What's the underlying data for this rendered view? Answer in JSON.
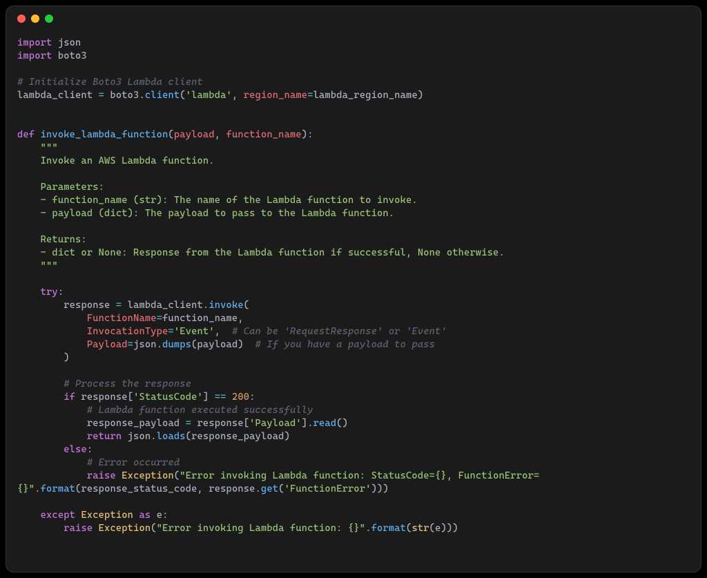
{
  "colors": {
    "window_bg": "#1b1b1b",
    "traffic_close": "#ff5f56",
    "traffic_min": "#ffbd2e",
    "traffic_max": "#27c93f",
    "keyword": "#c678dd",
    "module": "#e5c07b",
    "comment": "#5c6370",
    "string": "#98c379",
    "number": "#d19a66",
    "function": "#61afef",
    "variable": "#e06c75",
    "operator": "#56b6c2",
    "default": "#abb2bf"
  },
  "tokens": {
    "l1_import": "import",
    "l1_json": " json",
    "l2_import": "import",
    "l2_boto3": " boto3",
    "l4_cmt": "# Initialize Boto3 Lambda client",
    "l5_var": "lambda_client ",
    "l5_assign": "=",
    "l5_boto3": " boto3",
    "l5_dot1": ".",
    "l5_client": "client",
    "l5_p1": "(",
    "l5_str": "'lambda'",
    "l5_comma": ", ",
    "l5_kw": "region_name",
    "l5_eq": "=",
    "l5_rn": "lambda_region_name",
    "l5_p2": ")",
    "l8_def": "def",
    "l8_name": " invoke_lambda_function",
    "l8_p1": "(",
    "l8_a1": "payload",
    "l8_c1": ", ",
    "l8_a2": "function_name",
    "l8_p2": "):",
    "l9_doc": "    \"\"\"",
    "l10_doc": "    Invoke an AWS Lambda function.",
    "l12_doc": "    Parameters:",
    "l13_doc": "    - function_name (str): The name of the Lambda function to invoke.",
    "l14_doc": "    - payload (dict): The payload to pass to the Lambda function.",
    "l16_doc": "    Returns:",
    "l17_doc": "    - dict or None: Response from the Lambda function if successful, None otherwise.",
    "l18_doc": "    \"\"\"",
    "l20_try": "    try",
    "l20_colon": ":",
    "l21_ind": "        ",
    "l21_var": "response ",
    "l21_eq": "=",
    "l21_lc": " lambda_client",
    "l21_dot": ".",
    "l21_inv": "invoke",
    "l21_p": "(",
    "l22_ind": "            ",
    "l22_kw": "FunctionName",
    "l22_eq": "=",
    "l22_fn": "function_name",
    "l22_c": ",",
    "l23_ind": "            ",
    "l23_kw": "InvocationType",
    "l23_eq": "=",
    "l23_str": "'Event'",
    "l23_c": ",  ",
    "l23_cmt": "# Can be 'RequestResponse' or 'Event'",
    "l24_ind": "            ",
    "l24_kw": "Payload",
    "l24_eq": "=",
    "l24_json": "json",
    "l24_dot": ".",
    "l24_dumps": "dumps",
    "l24_p1": "(",
    "l24_pl": "payload",
    "l24_p2": ")  ",
    "l24_cmt": "# If you have a payload to pass",
    "l25": "        )",
    "l27_ind": "        ",
    "l27_cmt": "# Process the response",
    "l28_ind": "        ",
    "l28_if": "if",
    "l28_resp": " response",
    "l28_br1": "[",
    "l28_key": "'StatusCode'",
    "l28_br2": "] ",
    "l28_eq": "==",
    "l28_sp": " ",
    "l28_num": "200",
    "l28_colon": ":",
    "l29_ind": "            ",
    "l29_cmt": "# Lambda function executed successfully",
    "l30_ind": "            ",
    "l30_var": "response_payload ",
    "l30_eq": "=",
    "l30_resp": " response",
    "l30_br1": "[",
    "l30_key": "'Payload'",
    "l30_br2": "]",
    "l30_dot": ".",
    "l30_read": "read",
    "l30_p": "()",
    "l31_ind": "            ",
    "l31_ret": "return",
    "l31_json": " json",
    "l31_dot": ".",
    "l31_loads": "loads",
    "l31_p1": "(",
    "l31_rp": "response_payload",
    "l31_p2": ")",
    "l32_ind": "        ",
    "l32_else": "else",
    "l32_colon": ":",
    "l33_ind": "            ",
    "l33_cmt": "# Error occurred",
    "l34_ind": "            ",
    "l34_raise": "raise",
    "l34_exc": " Exception",
    "l34_p1": "(",
    "l34_str": "\"Error invoking Lambda function: StatusCode={}, FunctionError=\n{}\"",
    "l34_dot": ".",
    "l34_fmt": "format",
    "l34_p2": "(",
    "l34_a1": "response_status_code",
    "l34_c": ", ",
    "l34_a2": "response",
    "l34_dot2": ".",
    "l34_get": "get",
    "l34_p3": "(",
    "l34_key": "'FunctionError'",
    "l34_p4": ")))",
    "l36_ind": "    ",
    "l36_except": "except",
    "l36_exc": " Exception ",
    "l36_as": "as",
    "l36_e": " e",
    "l36_colon": ":",
    "l37_ind": "        ",
    "l37_raise": "raise",
    "l37_exc": " Exception",
    "l37_p1": "(",
    "l37_str": "\"Error invoking Lambda function: {}\"",
    "l37_dot": ".",
    "l37_fmt": "format",
    "l37_p2": "(",
    "l37_str2": "str",
    "l37_p3": "(",
    "l37_e": "e",
    "l37_p4": ")))"
  }
}
